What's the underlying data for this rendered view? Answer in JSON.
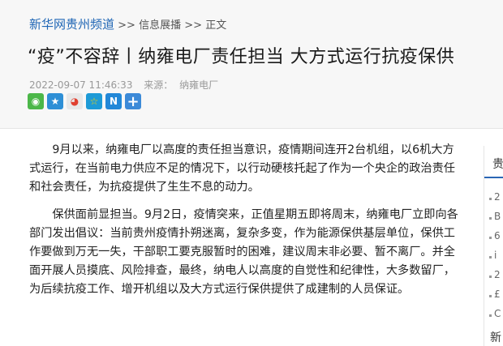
{
  "breadcrumb": {
    "site": "新华网贵州频道",
    "sep1": ">>",
    "section": "信息展播",
    "sep2": ">>",
    "current": "正文"
  },
  "article": {
    "title": "“疫”不容辞丨纳雍电厂责任担当 大方式运行抗疫保供",
    "date": "2022-09-07 11:46:33",
    "source_label": "来源：",
    "source": "纳雍电厂",
    "paragraphs": [
      "9月以来，纳雍电厂以高度的责任担当意识，疫情期间连开2台机组，以6机大方式运行，在当前电力供应不足的情况下，以行动硬核托起了作为一个央企的政治责任和社会责任，为抗疫提供了生生不息的动力。",
      "保供面前显担当。9月2日，疫情突来，正值星期五即将周末，纳雍电厂立即向各部门发出倡议：当前贵州疫情扑朔迷离，复杂多变，作为能源保供基层单位，保供工作要做到万无一失，干部职工要克服暂时的困难，建议周末非必要、暂不离厂。并全面开展人员摸底、风险排查，最终，纳电人以高度的自觉性和纪律性，大多数留厂，为后续抗疫工作、增开机组以及大方式运行保供提供了成建制的人员保证。"
    ]
  },
  "share": [
    {
      "icon": "wechat-icon",
      "glyph": "◉"
    },
    {
      "icon": "qzone-icon",
      "glyph": "★"
    },
    {
      "icon": "weibo-icon",
      "glyph": "◕"
    },
    {
      "icon": "qq-icon",
      "glyph": "☆"
    },
    {
      "icon": "n-icon",
      "glyph": "N"
    },
    {
      "icon": "more-icon",
      "glyph": "+"
    }
  ],
  "sidebar": {
    "heading": "贵",
    "items": [
      "2",
      "B",
      "6",
      "i",
      "2",
      "£",
      "C"
    ],
    "bottom": "新"
  }
}
